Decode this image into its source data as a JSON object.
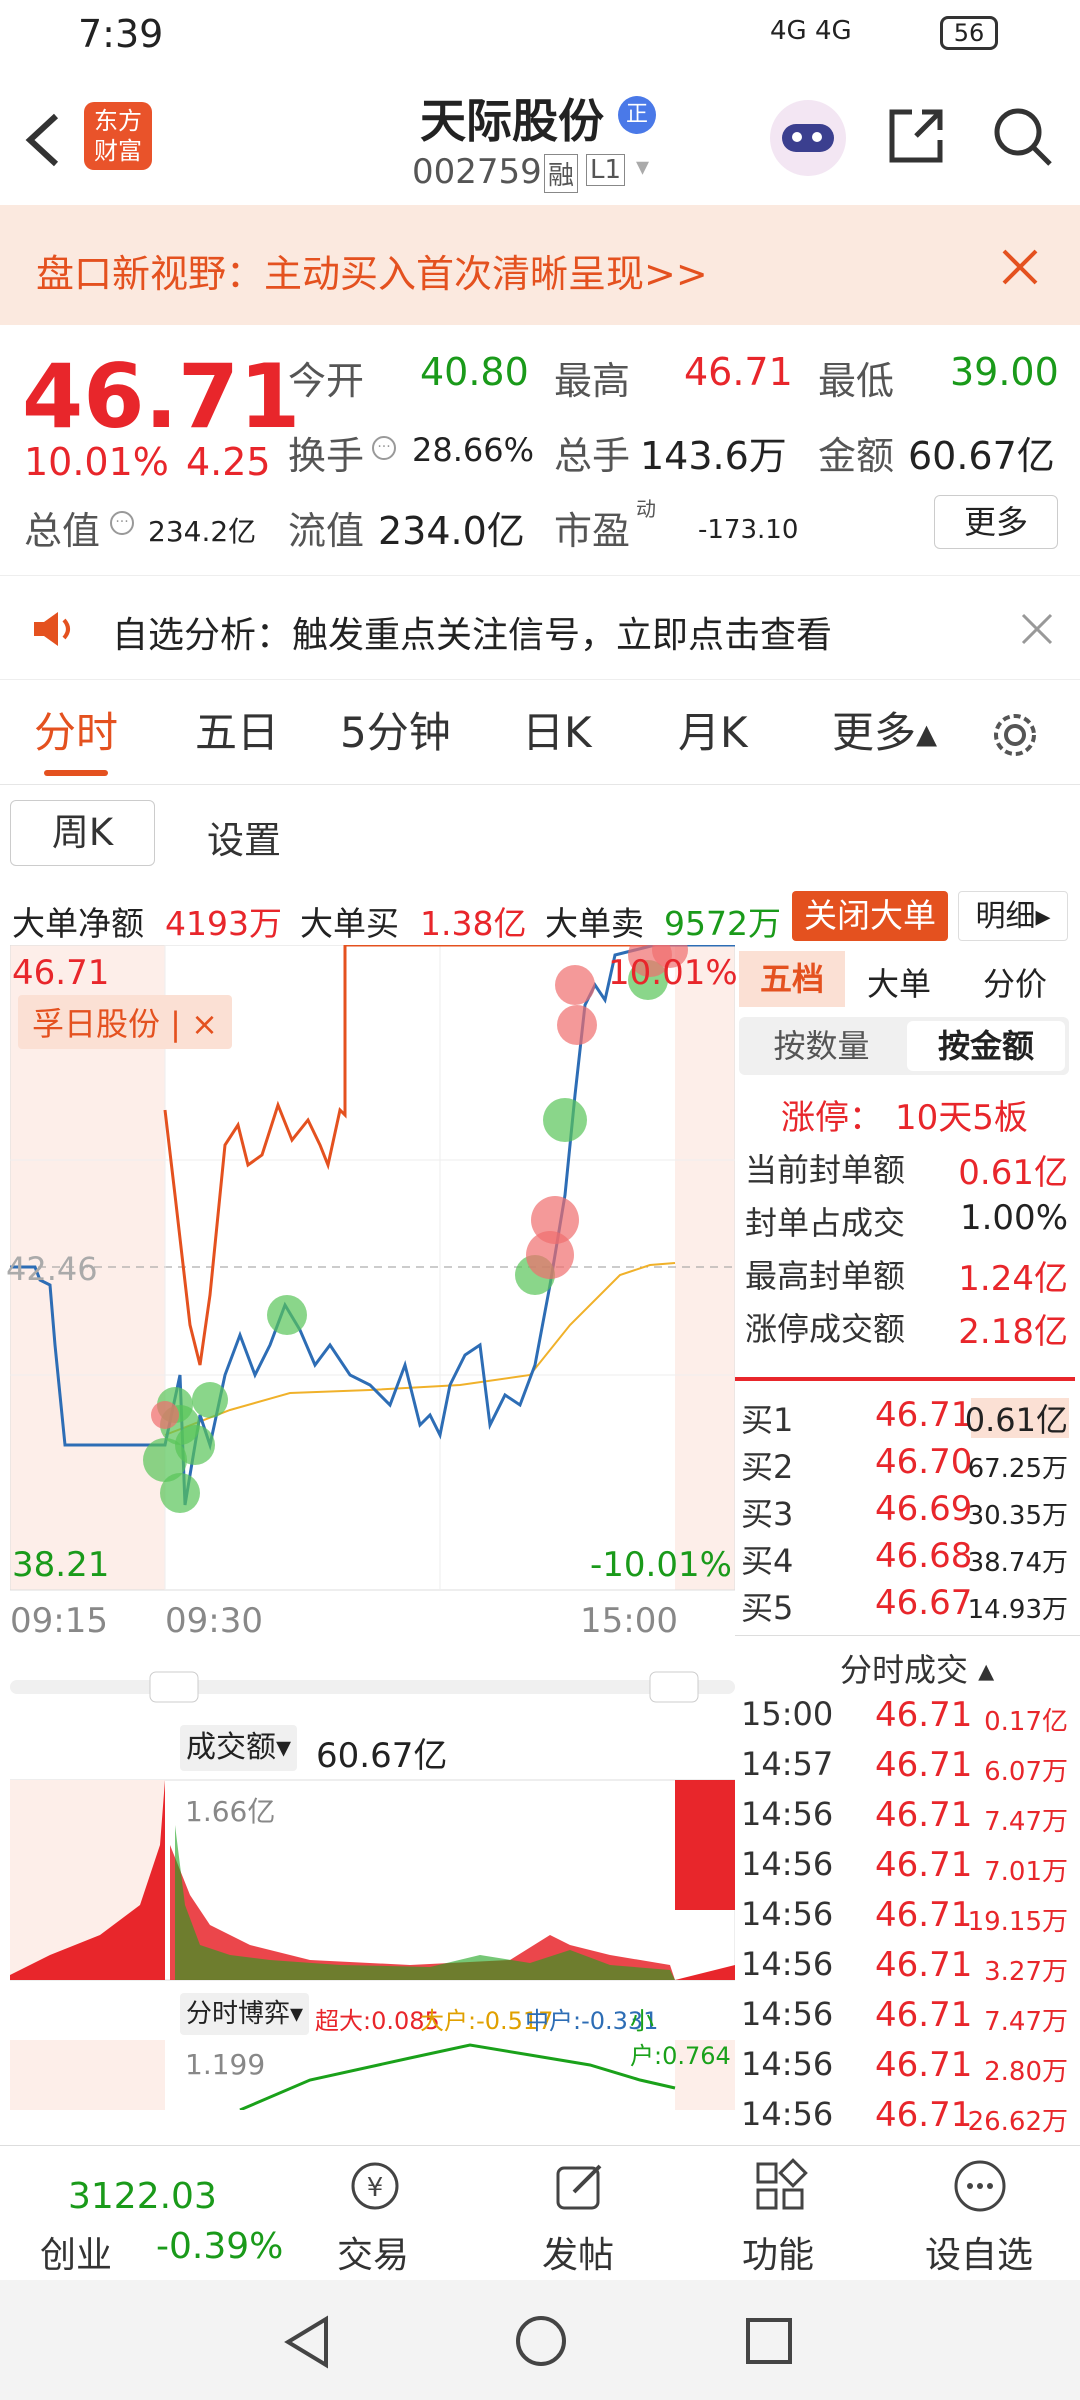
{
  "status": {
    "time": "7:39",
    "signal": "4G 4G",
    "battery": "56"
  },
  "header": {
    "logo_line1": "东方",
    "logo_line2": "财富",
    "title": "天际股份",
    "badge": "正",
    "code": "002759",
    "tag_rong": "融",
    "tag_level": "L1"
  },
  "banner": {
    "text": "盘口新视野：主动买入首次清晰呈现>>"
  },
  "quote": {
    "price": "46.71",
    "change_pct": "10.01%",
    "change": "4.25",
    "open_label": "今开",
    "open": "40.80",
    "high_label": "最高",
    "high": "46.71",
    "low_label": "最低",
    "low": "39.00",
    "turnover_label": "换手",
    "turnover": "28.66%",
    "volume_label": "总手",
    "volume": "143.6万",
    "amount_label": "金额",
    "amount": "60.67亿",
    "mcap_label": "总值",
    "mcap": "234.2亿",
    "float_label": "流值",
    "float": "234.0亿",
    "pe_label": "市盈",
    "pe_sup": "动",
    "pe": "-173.10",
    "more": "更多"
  },
  "notice": {
    "text": "自选分析：触发重点关注信号，立即点击查看"
  },
  "tabs": [
    {
      "label": "分时",
      "active": true
    },
    {
      "label": "五日"
    },
    {
      "label": "5分钟"
    },
    {
      "label": "日K"
    },
    {
      "label": "月K"
    },
    {
      "label": "更多▴"
    }
  ],
  "subtabs": {
    "weekk": "周K",
    "settings": "设置"
  },
  "flow": {
    "net_label": "大单净额",
    "net": "4193万",
    "buy_label": "大单买",
    "buy": "1.38亿",
    "sell_label": "大单卖",
    "sell": "9572万",
    "close_btn": "关闭大单",
    "detail_btn": "明细▸"
  },
  "chart": {
    "price_high": "46.71",
    "pct_high": "10.01%",
    "price_low": "38.21",
    "pct_low": "-10.01%",
    "mid": "42.46",
    "compare_label": "孚日股份 | ×",
    "times": [
      "09:15",
      "09:30",
      "15:00"
    ],
    "volume_label": "成交额▾",
    "volume_total": "60.67亿",
    "volume_max": "1.66亿",
    "game_label": "分时博弈▾",
    "game_super": "超大:0.085",
    "game_big": "大户:-0.517",
    "game_mid": "中户:-0.331",
    "game_small": "小户:0.764",
    "game_max": "1.199"
  },
  "chart_data": {
    "type": "line",
    "series": [
      {
        "name": "孚日股份",
        "values": [
          42.6,
          41.0,
          44.0,
          45.5,
          46.71,
          46.71
        ]
      },
      {
        "values": [
          42.46,
          41.4,
          40.5,
          41.5,
          40.8,
          41.0,
          43.5,
          46.71
        ]
      }
    ],
    "ylim": [
      38.21,
      46.71
    ]
  },
  "panel": {
    "tabs": [
      "五档",
      "大单",
      "分价"
    ],
    "sub": [
      "按数量",
      "按金额"
    ],
    "limit_label": "涨停：",
    "limit_val": "10天5板",
    "stats": [
      {
        "k": "当前封单额",
        "v": "0.61亿"
      },
      {
        "k": "封单占成交",
        "v": "1.00%"
      },
      {
        "k": "最高封单额",
        "v": "1.24亿"
      },
      {
        "k": "涨停成交额",
        "v": "2.18亿"
      }
    ],
    "bids": [
      {
        "k": "买1",
        "p": "46.71",
        "v": "0.61亿"
      },
      {
        "k": "买2",
        "p": "46.70",
        "v": "67.25万"
      },
      {
        "k": "买3",
        "p": "46.69",
        "v": "30.35万"
      },
      {
        "k": "买4",
        "p": "46.68",
        "v": "38.74万"
      },
      {
        "k": "买5",
        "p": "46.67",
        "v": "14.93万"
      }
    ],
    "trades_title": "分时成交 ▴",
    "trades": [
      {
        "t": "15:00",
        "p": "46.71",
        "v": "0.17亿"
      },
      {
        "t": "14:57",
        "p": "46.71",
        "v": "6.07万"
      },
      {
        "t": "14:56",
        "p": "46.71",
        "v": "7.47万"
      },
      {
        "t": "14:56",
        "p": "46.71",
        "v": "7.01万"
      },
      {
        "t": "14:56",
        "p": "46.71",
        "v": "19.15万"
      },
      {
        "t": "14:56",
        "p": "46.71",
        "v": "3.27万"
      },
      {
        "t": "14:56",
        "p": "46.71",
        "v": "7.47万"
      },
      {
        "t": "14:56",
        "p": "46.71",
        "v": "2.80万"
      },
      {
        "t": "14:56",
        "p": "46.71",
        "v": "26.62万"
      }
    ]
  },
  "bottom": {
    "index_val": "3122.03",
    "index_name": "创业",
    "index_pct": "-0.39%",
    "trade": "交易",
    "post": "发帖",
    "func": "功能",
    "watch": "设自选"
  }
}
